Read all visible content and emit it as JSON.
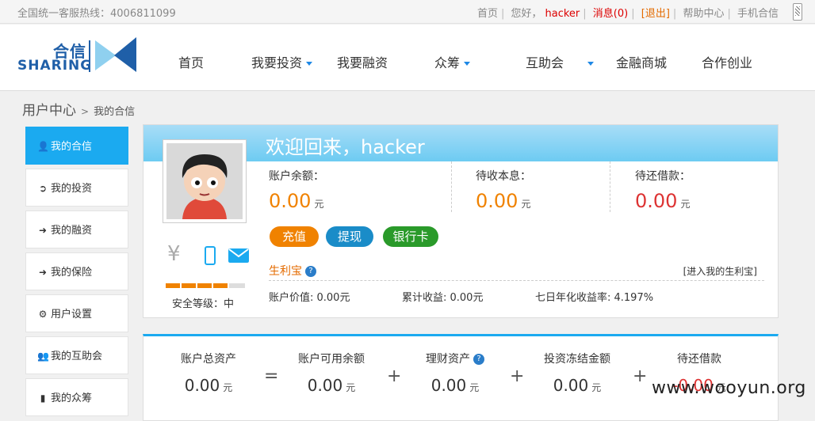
{
  "topbar": {
    "hotline": "全国统一客服热线：4006811099",
    "home": "首页",
    "greeting": "您好，",
    "username": "hacker",
    "messages": "消息(0)",
    "logout": "[退出]",
    "help": "帮助中心",
    "mobile": "手机合信"
  },
  "logo": {
    "cn": "合信",
    "en": "SHARING"
  },
  "nav": {
    "items": [
      "首页",
      "我要投资",
      "我要融资",
      "众筹",
      "互助会",
      "金融商城",
      "合作创业"
    ]
  },
  "breadcrumb": {
    "root": "用户中心",
    "sep": ">",
    "current": "我的合信"
  },
  "sidebar": {
    "items": [
      {
        "label": "我的合信",
        "icon": "user-icon"
      },
      {
        "label": "我的投资",
        "icon": "export-icon"
      },
      {
        "label": "我的融资",
        "icon": "import-icon"
      },
      {
        "label": "我的保险",
        "icon": "import-icon"
      },
      {
        "label": "用户设置",
        "icon": "gear-icon"
      },
      {
        "label": "我的互助会",
        "icon": "group-icon"
      },
      {
        "label": "我的众筹",
        "icon": "signal-icon"
      }
    ]
  },
  "profile": {
    "welcome": "欢迎回来，hacker",
    "security_label": "安全等级：中",
    "security_level": 0.8
  },
  "balance": {
    "account_label": "账户余额：",
    "account_value": "0.00",
    "interest_label": "待收本息：",
    "interest_value": "0.00",
    "loan_label": "待还借款：",
    "loan_value": "0.00",
    "unit": "元"
  },
  "buttons": {
    "recharge": "充值",
    "withdraw": "提现",
    "bankcard": "银行卡"
  },
  "shenglibao": {
    "title": "生利宝",
    "help": "?",
    "enter": "[进入我的生利宝]",
    "value": "账户价值: 0.00元",
    "gain": "累计收益: 0.00元",
    "rate": "七日年化收益率: 4.197%"
  },
  "summary": {
    "total_label": "账户总资产",
    "available_label": "账户可用余额",
    "finance_label": "理财资产",
    "frozen_label": "投资冻结金额",
    "loan_label": "待还借款",
    "value": "0.00",
    "unit": "元",
    "eq": "=",
    "plus": "+",
    "minus": "-"
  },
  "watermark": "www.wooyun.org",
  "colors": {
    "accent": "#1baaf0",
    "orange": "#f08200",
    "red": "#d33333",
    "green": "#2a9a2a",
    "blue_btn": "#1a8cc8"
  }
}
